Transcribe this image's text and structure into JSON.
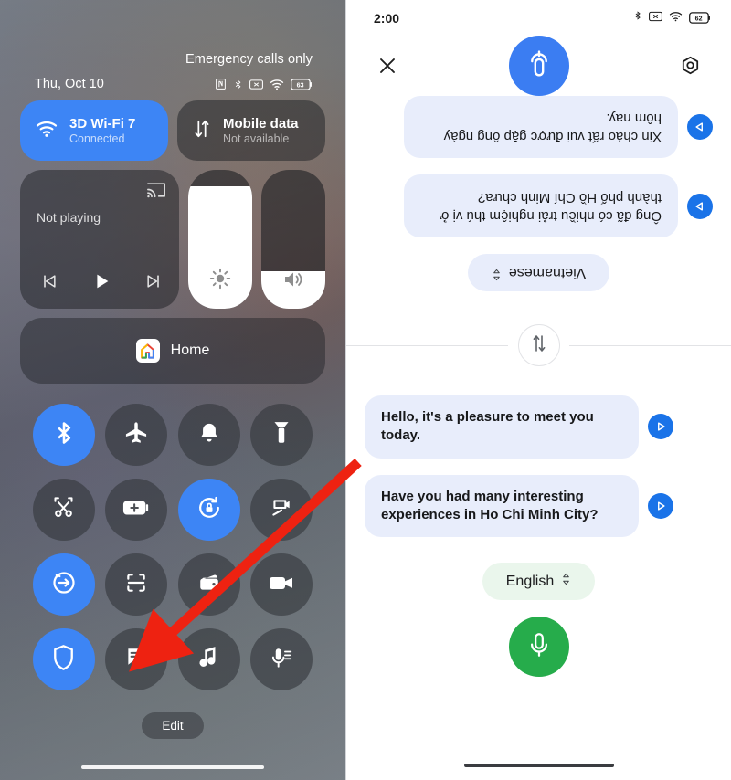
{
  "left_panel": {
    "carrier_status": "Emergency calls only",
    "date": "Thu, Oct 10",
    "status_icons": [
      "nfc-icon",
      "bluetooth-icon",
      "mute-icon",
      "wifi-icon",
      "battery-icon"
    ],
    "battery_percent": "63",
    "connectivity": [
      {
        "name": "wifi-tile",
        "title": "3D Wi-Fi 7",
        "subtitle": "Connected",
        "state": "active",
        "icon": "wifi-icon"
      },
      {
        "name": "mobile-data-tile",
        "title": "Mobile data",
        "subtitle": "Not available",
        "state": "inactive",
        "icon": "data-transfer-icon"
      }
    ],
    "media": {
      "status": "Not playing",
      "cast_icon": "cast-icon",
      "controls": [
        "previous-icon",
        "play-icon",
        "next-icon"
      ]
    },
    "sliders": [
      {
        "name": "brightness-slider",
        "icon": "brightness-icon",
        "level_percent": 88
      },
      {
        "name": "volume-slider",
        "icon": "volume-icon",
        "level_percent": 27
      }
    ],
    "home_card": {
      "label": "Home",
      "icon": "google-home-icon"
    },
    "tiles": [
      {
        "name": "bluetooth-tile",
        "icon": "bluetooth-icon",
        "on": true
      },
      {
        "name": "airplane-mode-tile",
        "icon": "airplane-icon",
        "on": false
      },
      {
        "name": "ring-mode-tile",
        "icon": "bell-icon",
        "on": false
      },
      {
        "name": "flashlight-tile",
        "icon": "flashlight-icon",
        "on": false
      },
      {
        "name": "screenshot-tile",
        "icon": "scissors-icon",
        "on": false
      },
      {
        "name": "battery-saver-tile",
        "icon": "battery-plus-icon",
        "on": false
      },
      {
        "name": "auto-rotate-tile",
        "icon": "rotate-lock-icon",
        "on": true
      },
      {
        "name": "screen-recorder-tile",
        "icon": "screen-record-icon",
        "on": false
      },
      {
        "name": "data-saver-tile",
        "icon": "data-saver-icon",
        "on": true
      },
      {
        "name": "qr-scanner-tile",
        "icon": "qr-scan-icon",
        "on": false
      },
      {
        "name": "wallet-tile",
        "icon": "wallet-icon",
        "on": false
      },
      {
        "name": "video-call-tile",
        "icon": "video-camera-icon",
        "on": false
      },
      {
        "name": "vpn-tile",
        "icon": "shield-icon",
        "on": true
      },
      {
        "name": "live-caption-tile",
        "icon": "live-caption-icon",
        "on": false
      },
      {
        "name": "music-id-tile",
        "icon": "music-note-icon",
        "on": false
      },
      {
        "name": "voice-recorder-tile",
        "icon": "microphone-lines-icon",
        "on": false
      }
    ],
    "edit_label": "Edit"
  },
  "right_panel": {
    "time": "2:00",
    "status_icons": [
      "bluetooth-icon",
      "mute-icon",
      "wifi-icon",
      "battery-icon"
    ],
    "battery_percent": "62",
    "header": {
      "close_label": "✕",
      "close_icon": "close-icon",
      "mic_icon": "translate-mic-icon",
      "settings_icon": "settings-gear-icon"
    },
    "top_side": {
      "language": "Vietnamese",
      "chevron_icon": "chevron-updown-icon",
      "messages": [
        {
          "text": "Ông đã có nhiều trải nghiệm thú vị ở thành phố Hồ Chí Minh chưa?",
          "play_icon": "play-icon"
        },
        {
          "text": "Xin chào rất vui được gặp ông ngày hôm nay.",
          "play_icon": "play-icon"
        }
      ]
    },
    "swap": {
      "icon": "swap-vertical-icon"
    },
    "bottom_side": {
      "language": "English",
      "chevron_icon": "chevron-updown-icon",
      "messages": [
        {
          "text": "Hello, it's a pleasure to meet you today.",
          "play_icon": "play-icon"
        },
        {
          "text": "Have you had many interesting experiences in Ho Chi Minh City?",
          "play_icon": "play-icon"
        }
      ]
    }
  },
  "annotation": {
    "arrow_color": "#ee2211",
    "arrow_target": "live-caption-tile"
  }
}
